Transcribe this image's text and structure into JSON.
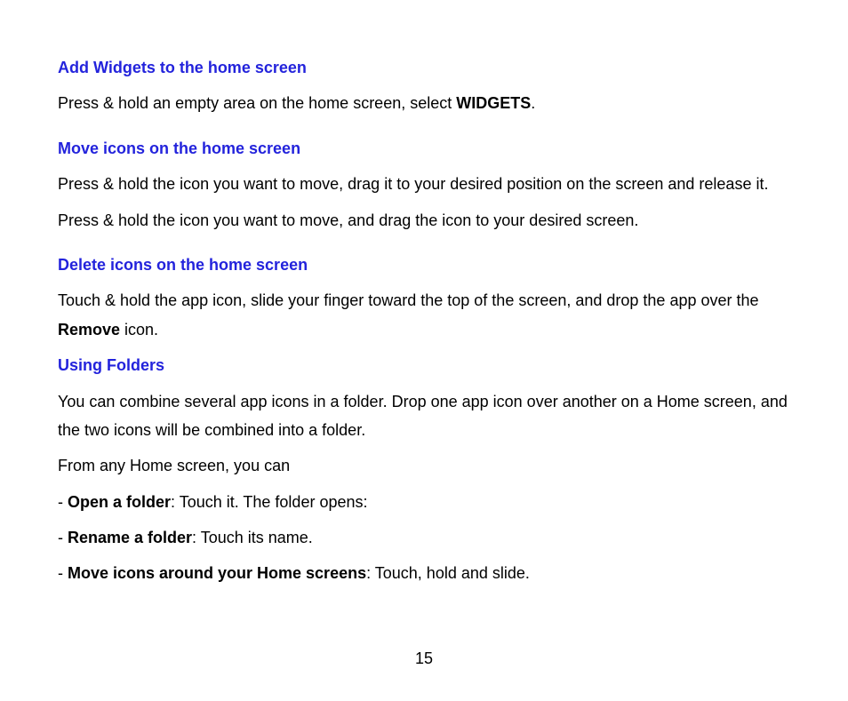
{
  "sections": {
    "addWidgets": {
      "heading": "Add Widgets to the home screen",
      "para1_part1": "Press & hold an empty area on the home screen, select ",
      "para1_bold": "WIDGETS",
      "para1_part2": "."
    },
    "moveIcons": {
      "heading": "Move icons on the home screen",
      "para1": "Press & hold the icon you want to move, drag it to your desired position on the screen and release it.",
      "para2": "Press & hold the icon you want to move, and drag the icon to your desired screen."
    },
    "deleteIcons": {
      "heading": "Delete icons on the home screen",
      "para1_part1": "Touch & hold the app icon, slide your finger toward the top of the screen, and drop the app over the ",
      "para1_bold": "Remove",
      "para1_part2": " icon."
    },
    "usingFolders": {
      "heading": "Using Folders",
      "para1": "You can combine several app icons in a folder. Drop one app icon over another on a Home screen, and the two icons will be combined into a folder.",
      "para2": "From any Home screen, you can",
      "item1_prefix": "- ",
      "item1_bold": "Open a folder",
      "item1_rest": ": Touch it. The folder opens:",
      "item2_prefix": "- ",
      "item2_bold": "Rename a folder",
      "item2_rest": ": Touch its name.",
      "item3_prefix": "- ",
      "item3_bold": "Move icons around your Home screens",
      "item3_rest": ": Touch, hold and slide."
    }
  },
  "pageNumber": "15"
}
